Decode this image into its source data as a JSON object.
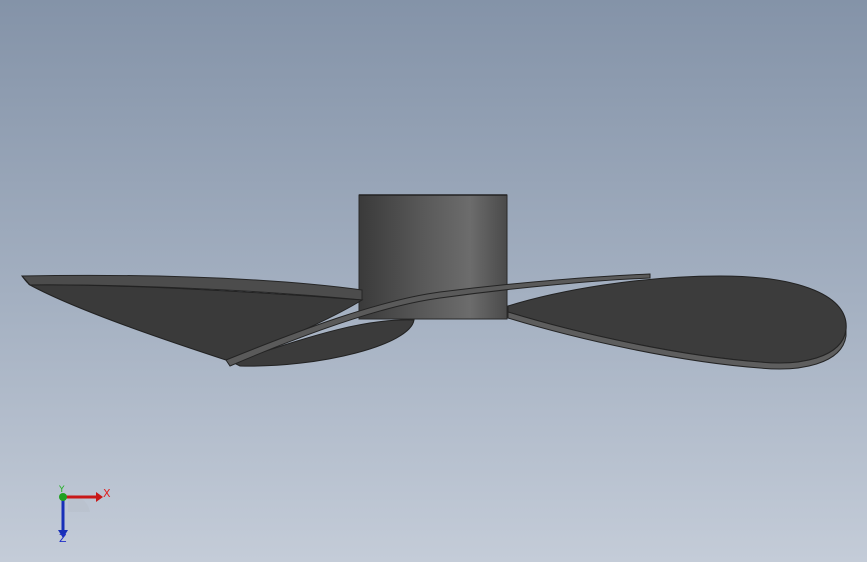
{
  "viewport": {
    "background_top": "#8493a8",
    "background_bottom": "#c4ccd8"
  },
  "model": {
    "name": "propeller",
    "face_color": "#3c3c3c",
    "edge_color": "#5a5a5a",
    "hub_color": "#4a4a4a"
  },
  "triad": {
    "x_label": "X",
    "y_label": "Y",
    "z_label": "Z",
    "x_color": "#e02020",
    "y_color": "#20b020",
    "z_color": "#2030c8"
  }
}
